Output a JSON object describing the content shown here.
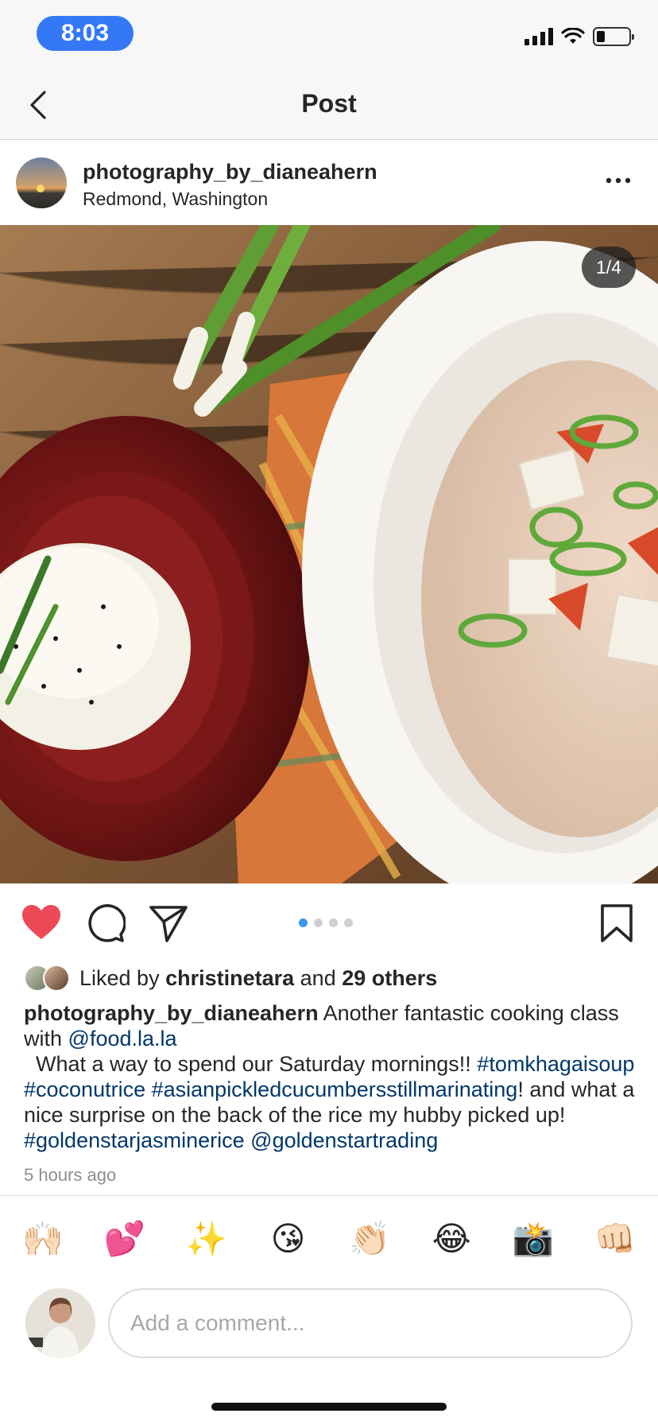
{
  "status_bar": {
    "time": "8:03"
  },
  "nav": {
    "title": "Post"
  },
  "post": {
    "username": "photography_by_dianeahern",
    "location": "Redmond, Washington",
    "image_counter": "1/4",
    "carousel": {
      "total": 4,
      "active": 1
    },
    "likes": {
      "prefix": "Liked by ",
      "first_liker": "christinetara",
      "middle": " and ",
      "others": "29 others"
    },
    "caption": {
      "username": "photography_by_dianeahern",
      "t1": " Another fantastic cooking class with ",
      "mention1": "@food.la.la",
      "t2": "  What a way to spend our Saturday mornings!! ",
      "tag1": "#tomkhagaisoup",
      "t3": " ",
      "tag2": "#coconutrice",
      "t4": " ",
      "tag3": "#asianpickledcucumbersstillmarinating",
      "t5": "! and what a nice surprise on the back of the rice my hubby picked up! ",
      "tag4": "#goldenstarjasminerice",
      "t6": " ",
      "mention2": "@goldenstartrading"
    },
    "time_ago": "5 hours ago"
  },
  "emoji_reactions": [
    "🙌🏻",
    "💕",
    "✨",
    "😘",
    "👏🏻",
    "😂",
    "📸",
    "👊🏻"
  ],
  "comment": {
    "placeholder": "Add a comment..."
  },
  "colors": {
    "accent": "#3897f0",
    "like_red": "#ed4956",
    "link": "#00376b",
    "time_pill": "#3478f6"
  },
  "icons": [
    "back-chevron-icon",
    "more-icon",
    "heart-icon",
    "comment-icon",
    "share-icon",
    "bookmark-icon"
  ]
}
